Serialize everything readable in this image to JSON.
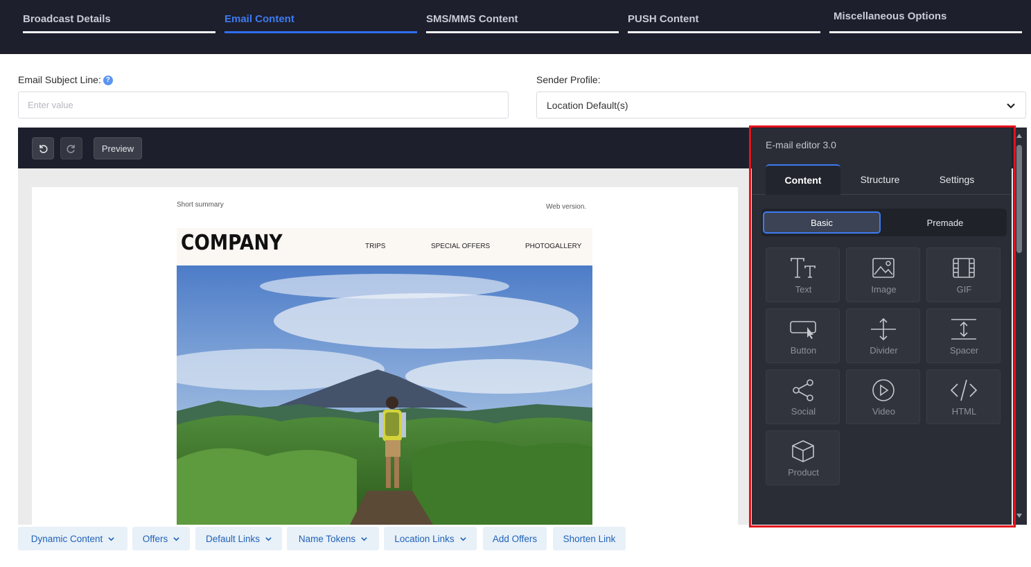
{
  "tabs": [
    {
      "label": "Broadcast Details",
      "active": false
    },
    {
      "label": "Email Content",
      "active": true
    },
    {
      "label": "SMS/MMS Content",
      "active": false
    },
    {
      "label": "PUSH Content",
      "active": false
    },
    {
      "label": "Miscellaneous Options",
      "active": false
    }
  ],
  "subject": {
    "label": "Email Subject Line:",
    "placeholder": "Enter value",
    "help_icon": "question-circle-icon"
  },
  "sender": {
    "label": "Sender Profile:",
    "value": "Location Default(s)"
  },
  "toolbar": {
    "preview_label": "Preview",
    "undo_icon": "undo-icon",
    "redo_icon": "redo-icon"
  },
  "email": {
    "summary": "Short summary",
    "web_version": "Web version.",
    "company": "COMPANY",
    "nav": [
      "TRIPS",
      "SPECIAL OFFERS",
      "PHOTOGALLERY"
    ]
  },
  "panel": {
    "title": "E-mail editor 3.0",
    "tabs": [
      "Content",
      "Structure",
      "Settings"
    ],
    "segments": [
      "Basic",
      "Premade"
    ],
    "blocks": [
      {
        "label": "Text",
        "icon": "text-icon"
      },
      {
        "label": "Image",
        "icon": "image-icon"
      },
      {
        "label": "GIF",
        "icon": "gif-icon"
      },
      {
        "label": "Button",
        "icon": "button-icon"
      },
      {
        "label": "Divider",
        "icon": "divider-icon"
      },
      {
        "label": "Spacer",
        "icon": "spacer-icon"
      },
      {
        "label": "Social",
        "icon": "share-icon"
      },
      {
        "label": "Video",
        "icon": "play-icon"
      },
      {
        "label": "HTML",
        "icon": "code-icon"
      },
      {
        "label": "Product",
        "icon": "box-icon"
      }
    ]
  },
  "bottom_buttons": [
    {
      "label": "Dynamic Content",
      "dropdown": true
    },
    {
      "label": "Offers",
      "dropdown": true
    },
    {
      "label": "Default Links",
      "dropdown": true
    },
    {
      "label": "Name Tokens",
      "dropdown": true
    },
    {
      "label": "Location Links",
      "dropdown": true
    },
    {
      "label": "Add Offers",
      "dropdown": false
    },
    {
      "label": "Shorten Link",
      "dropdown": false
    }
  ],
  "colors": {
    "nav_bg": "#1d1f2c",
    "accent": "#3d7bf2",
    "panel_bg": "#2a2d36",
    "highlight": "#e3121b",
    "bottom_btn_text": "#1f62b8"
  }
}
